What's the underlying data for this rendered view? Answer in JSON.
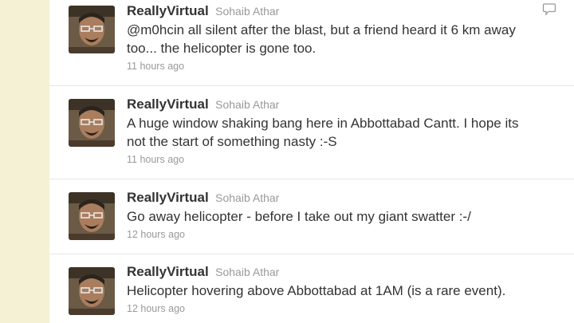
{
  "user": {
    "screen_name": "ReallyVirtual",
    "full_name": "Sohaib Athar"
  },
  "tweets": [
    {
      "text_lines": [
        "@m0hcin all silent after the blast, but a friend heard it 6 km away",
        "too... the helicopter is gone too."
      ],
      "time": "11 hours ago"
    },
    {
      "text_lines": [
        "A huge window shaking bang here in Abbottabad Cantt. I hope its",
        "not the start of something nasty :-S"
      ],
      "time": "11 hours ago"
    },
    {
      "text_lines": [
        "Go away helicopter - before I take out my giant swatter :-/"
      ],
      "time": "12 hours ago"
    },
    {
      "text_lines": [
        "Helicopter hovering above Abbottabad at 1AM (is a rare event)."
      ],
      "time": "12 hours ago"
    }
  ],
  "colors": {
    "accent_background": "#f3efd0",
    "name_text": "#333333",
    "meta_text": "#999999"
  },
  "icons": {
    "reply": "speech-bubble-icon"
  }
}
